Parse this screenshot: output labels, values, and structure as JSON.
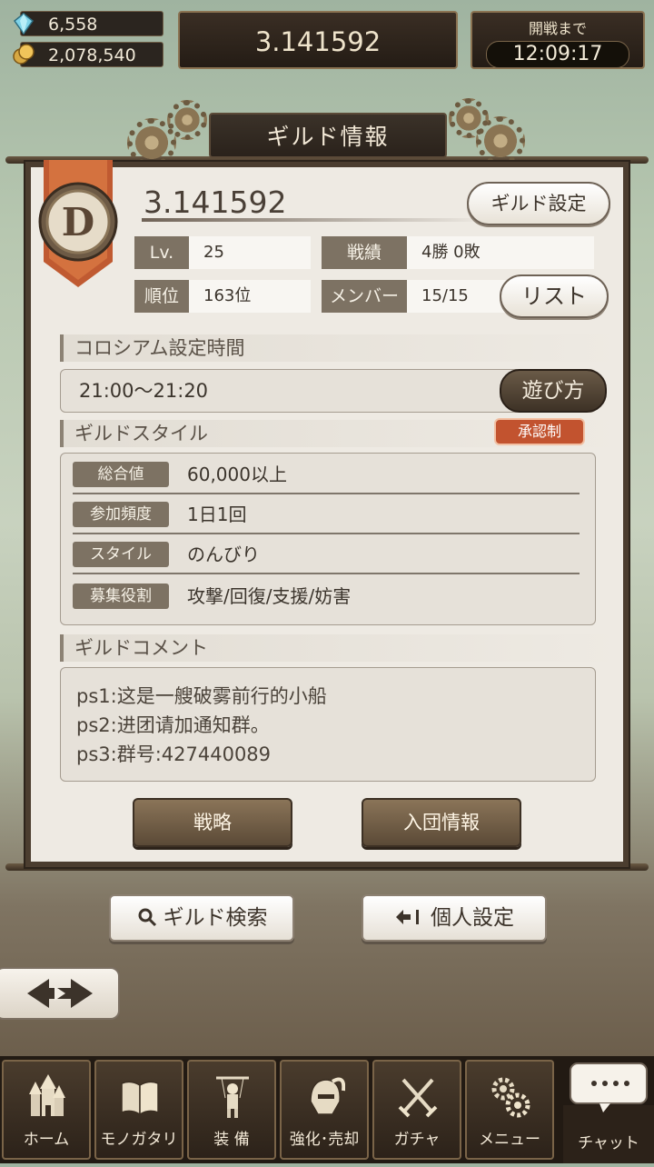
{
  "resources": {
    "gems": "6,558",
    "coins": "2,078,540"
  },
  "header": {
    "title": "3.141592",
    "battle_label": "開戦まで",
    "battle_time": "12:09:17"
  },
  "panel": {
    "title": "ギルド情報",
    "emblem_letter": "D",
    "guild_name": "3.141592",
    "guild_settings_label": "ギルド設定",
    "stats": {
      "lv_label": "Lv.",
      "lv_value": "25",
      "record_label": "戦績",
      "record_value": "4勝 0敗",
      "rank_label": "順位",
      "rank_value": "163位",
      "member_label": "メンバー",
      "member_value": "15/15"
    },
    "list_label": "リスト",
    "colosseum": {
      "title": "コロシアム設定時間",
      "time": "21:00〜21:20",
      "howto_label": "遊び方"
    },
    "style": {
      "title": "ギルドスタイル",
      "badge": "承認制",
      "rows": [
        {
          "label": "総合値",
          "value": "60,000以上"
        },
        {
          "label": "参加頻度",
          "value": "1日1回"
        },
        {
          "label": "スタイル",
          "value": "のんびり"
        },
        {
          "label": "募集役割",
          "value": "攻撃/回復/支援/妨害"
        }
      ]
    },
    "comment": {
      "title": "ギルドコメント",
      "lines": [
        "ps1:这是一艘破雾前行的小船",
        "ps2:进团请加通知群。",
        "ps3:群号:427440089"
      ]
    },
    "strategy_label": "戦略",
    "join_info_label": "入団情報"
  },
  "actions": {
    "search_label": "ギルド検索",
    "personal_label": "個人設定"
  },
  "nav": {
    "items": [
      "ホーム",
      "モノガタリ",
      "装 備",
      "強化･売却",
      "ガチャ",
      "メニュー"
    ],
    "chat_label": "チャット"
  },
  "colors": {
    "accent": "#c2532f",
    "panel": "#eeeae3",
    "frame": "#4b3d2f"
  }
}
